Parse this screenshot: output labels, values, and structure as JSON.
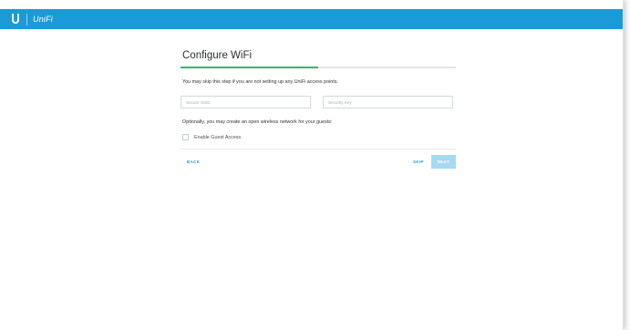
{
  "header": {
    "logo_icon": "ubiquiti-u-logo-icon",
    "brand": "UniFi",
    "bar_color": "#1a9bd7"
  },
  "wizard": {
    "title": "Configure WiFi",
    "progress_percent": 50,
    "progress_color": "#39b56b",
    "description": "You may skip this step if you are not setting up any UniFi access points.",
    "ssid_placeholder": "Secure SSID",
    "security_key_placeholder": "Security Key",
    "guest_description": "Optionally, you may create an open wireless network for your guests:",
    "guest_checkbox_label": "Enable Guest Access",
    "guest_checkbox_checked": false
  },
  "footer": {
    "back_label": "BACK",
    "skip_label": "SKIP",
    "next_label": "NEXT",
    "accent_color": "#1a9bd7"
  }
}
